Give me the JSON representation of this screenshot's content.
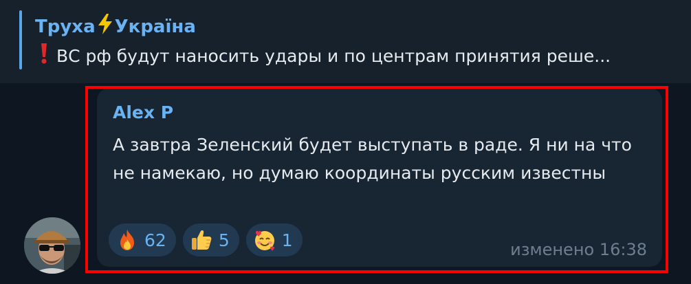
{
  "reply": {
    "channel_part1": "Труха",
    "channel_part2": "Україна",
    "channel_icon": "lightning-icon",
    "text": "ВС рф будут наносить удары и по центрам принятия реше...",
    "text_icon": "exclamation-icon"
  },
  "message": {
    "author": "Alex P",
    "text": "А завтра Зеленский будет выступать в раде. Я ни на что не намекаю, но думаю координаты русским известны",
    "edited_label": "изменено",
    "time": "16:38"
  },
  "reactions": [
    {
      "icon": "fire-emoji-icon",
      "count": "62"
    },
    {
      "icon": "thumbs-up-emoji-icon",
      "count": "5"
    },
    {
      "icon": "smiling-face-with-hearts-emoji-icon",
      "count": "1"
    }
  ],
  "colors": {
    "background": "#0e1621",
    "bubble": "#182533",
    "accent": "#6ab2f2",
    "highlight": "#ff0000"
  }
}
